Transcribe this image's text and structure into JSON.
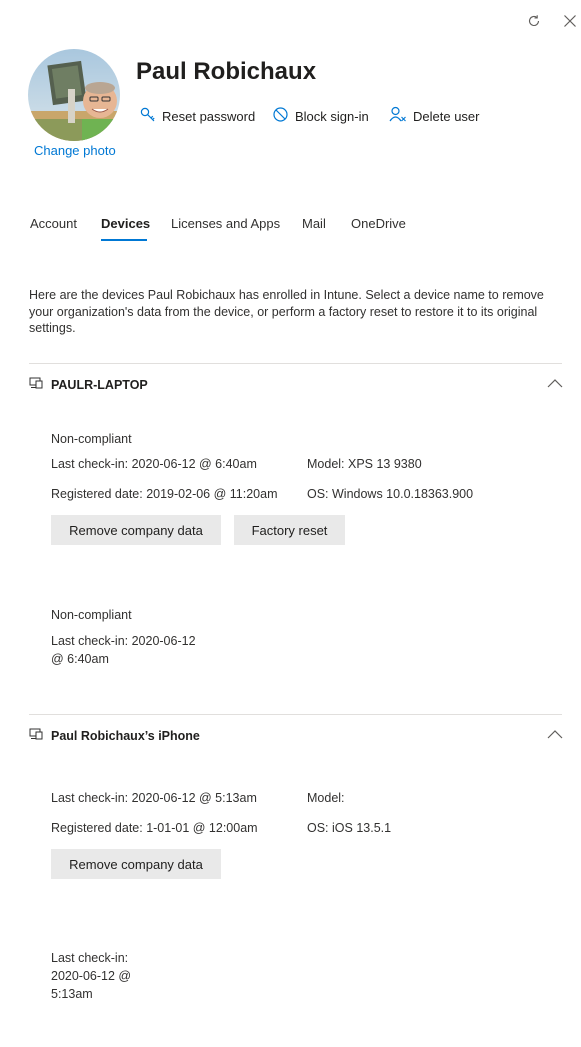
{
  "panel": {
    "refresh_icon": "refresh-icon",
    "close_icon": "close-icon"
  },
  "user": {
    "name": "Paul Robichaux",
    "change_photo": "Change photo"
  },
  "actions": {
    "reset_password": "Reset password",
    "block_signin": "Block sign-in",
    "delete_user": "Delete user"
  },
  "tabs": [
    {
      "label": "Account"
    },
    {
      "label": "Devices"
    },
    {
      "label": "Licenses and Apps"
    },
    {
      "label": "Mail"
    },
    {
      "label": "OneDrive"
    }
  ],
  "intro": "Here are the devices Paul Robichaux has enrolled in Intune. Select a device name to remove your organization's data from the device, or perform a factory reset to restore it to its original settings.",
  "devices": [
    {
      "name": "PAULR-LAPTOP",
      "status": "Non-compliant",
      "last_checkin": "Last check-in: 2020-06-12 @ 6:40am",
      "model": "Model: XPS 13 9380",
      "registered": "Registered date: 2019-02-06 @ 11:20am",
      "os": "OS: Windows 10.0.18363.900",
      "remove_label": "Remove company data",
      "reset_label": "Factory reset",
      "compact_status": "Non-compliant",
      "compact_line1": "Last check-in: 2020-06-12",
      "compact_line2": "@ 6:40am"
    },
    {
      "name": "Paul Robichaux’s iPhone",
      "last_checkin": "Last check-in: 2020-06-12 @ 5:13am",
      "model": "Model:",
      "registered": "Registered date: 1-01-01 @ 12:00am",
      "os": "OS: iOS 13.5.1",
      "remove_label": "Remove company data",
      "compact_line1": "Last check-in:",
      "compact_line2": "2020-06-12 @",
      "compact_line3": "5:13am"
    }
  ],
  "colors": {
    "accent": "#0078d4",
    "button_bg": "#e9e9e9",
    "divider": "#e1dfdd"
  }
}
